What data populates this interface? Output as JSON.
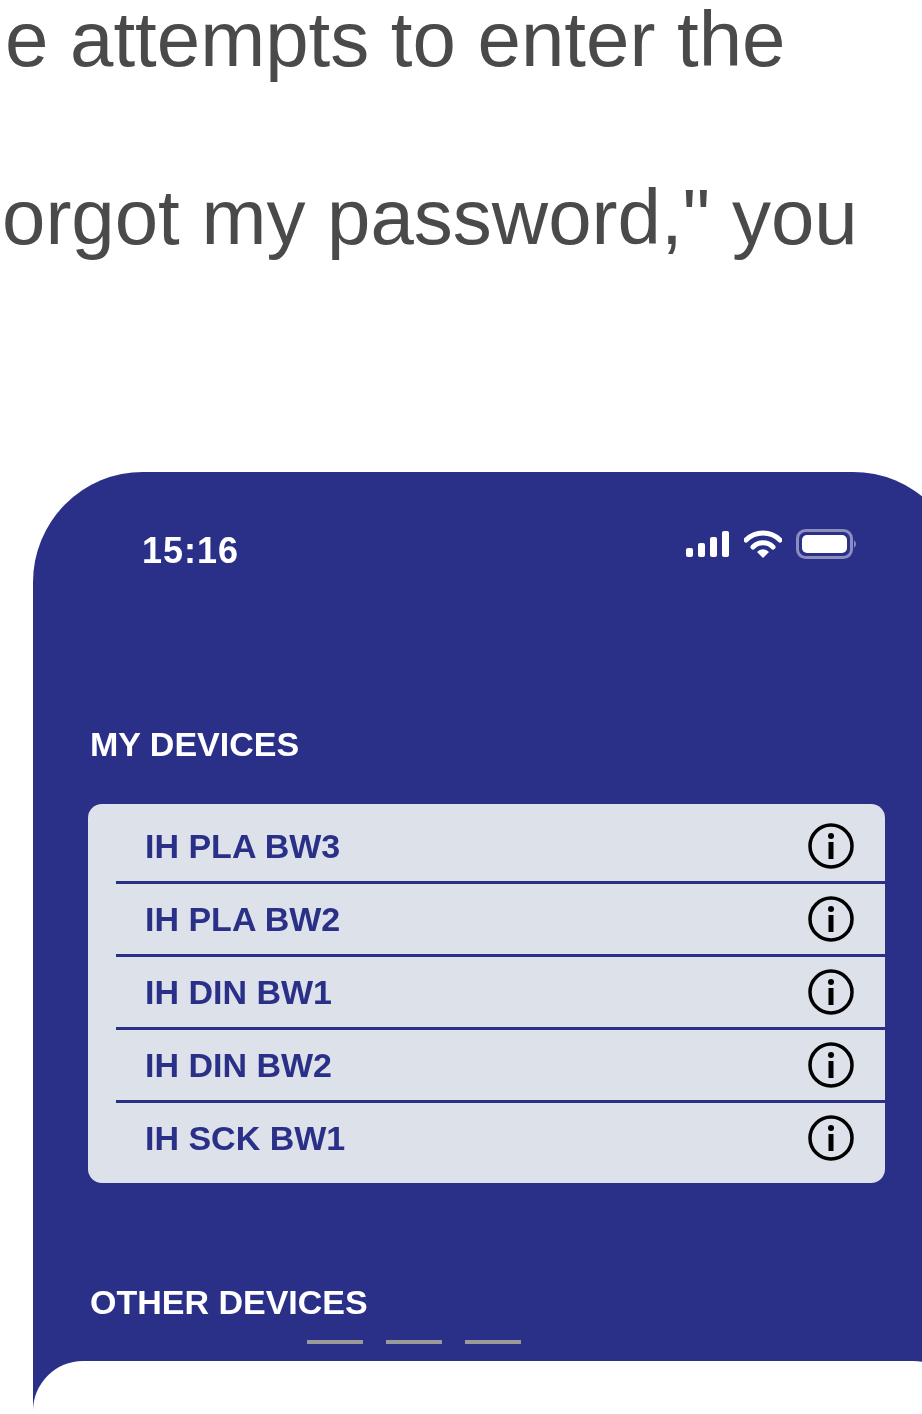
{
  "article": {
    "lines": [
      "e attempts to enter the",
      "orgot my password,\" you"
    ]
  },
  "phone": {
    "status_bar": {
      "time": "15:16"
    },
    "my_devices": {
      "title": "MY DEVICES",
      "items": [
        {
          "name": "IH PLA BW3"
        },
        {
          "name": "IH PLA BW2"
        },
        {
          "name": "IH DIN BW1"
        },
        {
          "name": "IH DIN BW2"
        },
        {
          "name": "IH SCK BW1"
        }
      ]
    },
    "other_devices": {
      "title": "OTHER DEVICES"
    }
  }
}
